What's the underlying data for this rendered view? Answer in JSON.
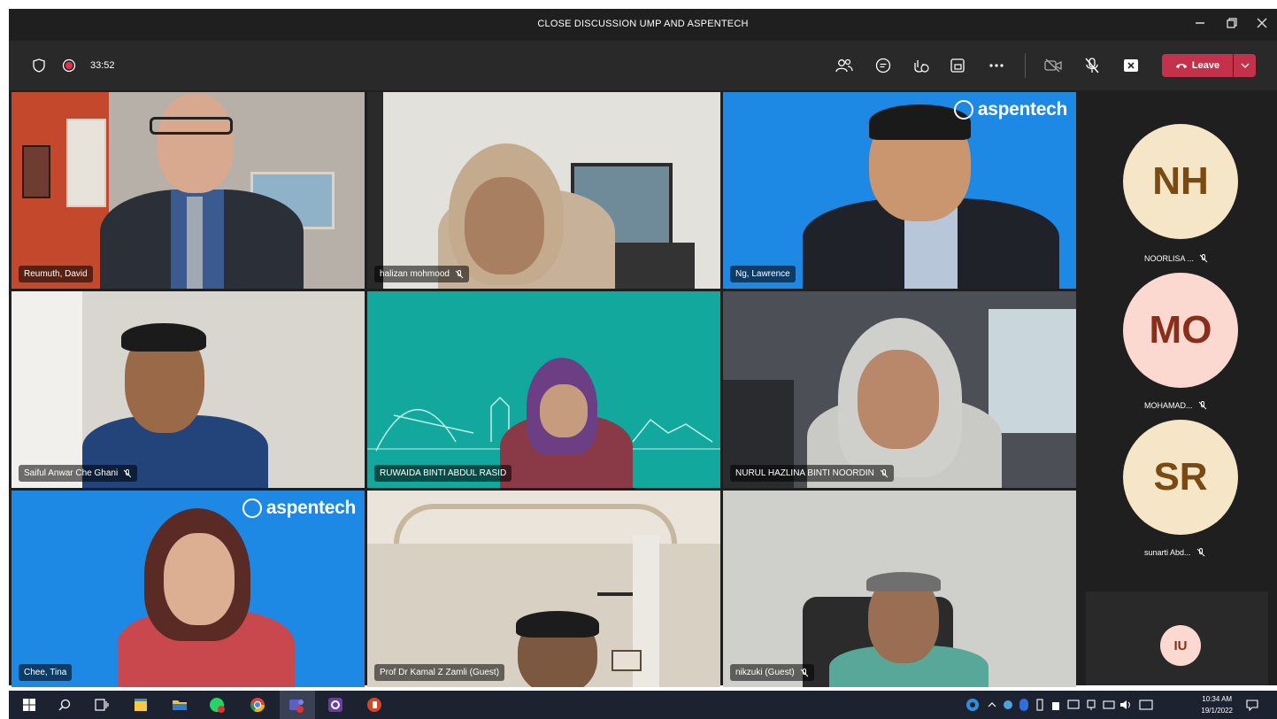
{
  "window": {
    "title": "CLOSE DISCUSSION UMP AND ASPENTECH",
    "controls": [
      "minimize-icon",
      "maximize-icon",
      "close-icon"
    ]
  },
  "toolbar": {
    "timer": "33:52",
    "left_icons": [
      "shield-icon",
      "recording-icon"
    ],
    "right_icons": [
      "people-icon",
      "chat-icon",
      "reactions-icon",
      "share-tray-icon",
      "more-icon",
      "camera-off-icon",
      "mic-off-icon",
      "share-screen-icon"
    ],
    "leave_label": "Leave",
    "leave_color": "#c4314b"
  },
  "participants": [
    {
      "name": "Reumuth, David",
      "muted": false
    },
    {
      "name": "halizan mohmood",
      "muted": true
    },
    {
      "name": "Ng, Lawrence",
      "muted": false
    },
    {
      "name": "Saiful Anwar Che Ghani",
      "muted": true
    },
    {
      "name": "RUWAIDA BINTI ABDUL RASID",
      "muted": false
    },
    {
      "name": "NURUL HAZLINA BINTI NOORDIN",
      "muted": true
    },
    {
      "name": "Chee, Tina",
      "muted": false
    },
    {
      "name": "Prof Dr Kamal Z Zamli (Guest)",
      "muted": false
    },
    {
      "name": "nikzuki (Guest)",
      "muted": true
    }
  ],
  "branding": {
    "logo_text": "aspentech",
    "bg_color": "#1e88e5"
  },
  "side_participants": [
    {
      "initials": "NH",
      "name": "NOORLISA ...",
      "muted": true,
      "bg": "#f5e6c8",
      "fg": "#7a4a12"
    },
    {
      "initials": "MO",
      "name": "MOHAMAD...",
      "muted": true,
      "bg": "#fbd9d1",
      "fg": "#8a2e1c"
    },
    {
      "initials": "SR",
      "name": "sunarti Abd...",
      "muted": true,
      "bg": "#f5e6c8",
      "fg": "#7a4a12"
    },
    {
      "initials": "IU",
      "name": "",
      "muted": false,
      "bg": "#fbd9d1",
      "fg": "#8a2e1c"
    }
  ],
  "taskbar": {
    "time": "10:34 AM",
    "date": "19/1/2022",
    "apps": [
      "windows-start-icon",
      "search-icon",
      "task-view-icon",
      "sticky-notes-icon",
      "file-explorer-icon",
      "whatsapp-icon",
      "chrome-icon",
      "teams-icon",
      "app-g-icon",
      "powerpoint-icon"
    ]
  }
}
